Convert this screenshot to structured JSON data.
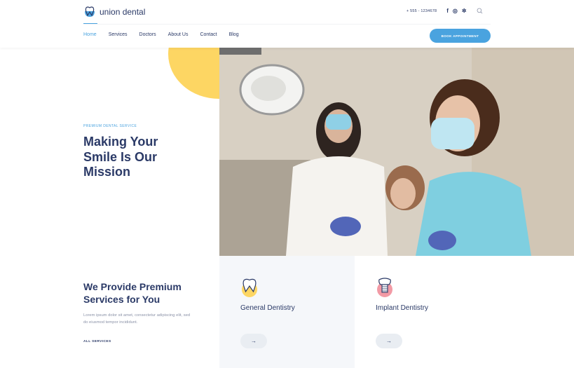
{
  "brand": {
    "name": "union dental",
    "logo_icon": "tooth-icon",
    "accent_color": "#4aa3df",
    "highlight_color": "#fdd663",
    "text_color": "#2b3a67"
  },
  "nav": {
    "items": [
      {
        "label": "Home",
        "active": true
      },
      {
        "label": "Services",
        "active": false
      },
      {
        "label": "Doctors",
        "active": false
      },
      {
        "label": "About Us",
        "active": false
      },
      {
        "label": "Contact",
        "active": false
      },
      {
        "label": "Blog",
        "active": false
      }
    ]
  },
  "topbar": {
    "phone": "+ 555 - 1234678",
    "social": [
      {
        "name": "facebook-icon",
        "glyph": "f"
      },
      {
        "name": "instagram-icon",
        "glyph": "◎"
      },
      {
        "name": "yelp-icon",
        "glyph": "✲"
      }
    ],
    "search_icon": "⌕",
    "cta_label": "BOOK APPOINTMENT"
  },
  "hero": {
    "eyebrow": "PREMIUM DENTAL SERVICE",
    "title": "Making Your Smile Is Our Mission",
    "image_alt": "Dentist and assistant in masks with patient in dental chair"
  },
  "services": {
    "title": "We Provide Premium Services for You",
    "description": "Lorem ipsum dolor sit amet, consectetur adipiscing elit, sed do eiusmod tempor incididunt.",
    "link_label": "ALL SERVICES",
    "cards": [
      {
        "title": "General Dentistry",
        "icon": "tooth-icon",
        "icon_bg": "#fdd663",
        "button": "→"
      },
      {
        "title": "Implant Dentistry",
        "icon": "implant-icon",
        "icon_bg": "#f29aa5",
        "button": "→"
      }
    ]
  }
}
